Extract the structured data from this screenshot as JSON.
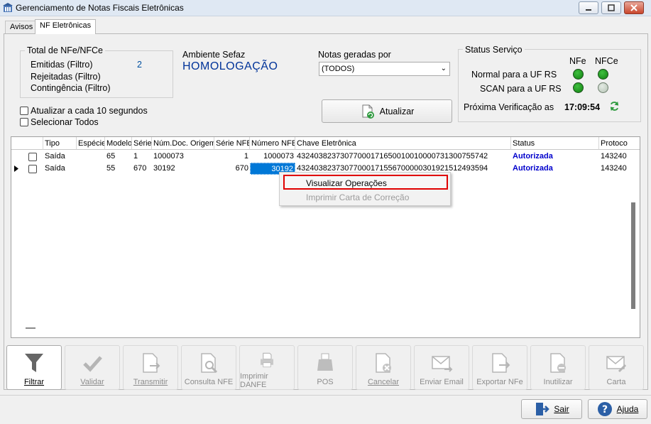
{
  "window": {
    "title": "Gerenciamento de Notas Fiscais Eletrônicas"
  },
  "tabs": [
    {
      "label": "Avisos"
    },
    {
      "label": "NF Eletrônicas"
    }
  ],
  "totals": {
    "legend": "Total de NFe/NFCe",
    "emitidas_label": "Emitidas (Filtro)",
    "emitidas_value": "2",
    "rejeitadas_label": "Rejeitadas (Filtro)",
    "contingencia_label": "Contingência (Filtro)"
  },
  "ambiente": {
    "label": "Ambiente Sefaz",
    "value": "HOMOLOGAÇÃO",
    "value_color": "#003399"
  },
  "notas": {
    "label": "Notas geradas por",
    "selected": "(TODOS)"
  },
  "options": {
    "auto_refresh_label": "Atualizar a cada 10 segundos",
    "select_all_label": "Selecionar Todos"
  },
  "refresh_button": {
    "label": "Atualizar"
  },
  "status": {
    "legend": "Status Serviço",
    "col_nfe": "NFe",
    "col_nfce": "NFCe",
    "rows": [
      {
        "label": "Normal para a UF RS",
        "nfe": "on",
        "nfce": "on"
      },
      {
        "label": "SCAN para a UF RS",
        "nfe": "on",
        "nfce": "off"
      }
    ],
    "next_check_label": "Próxima Verificação as",
    "next_check_time": "17:09:54"
  },
  "grid": {
    "columns": [
      "Tipo",
      "Espécie",
      "Modelo",
      "Série",
      "Núm.Doc. Origem",
      "Série NFE",
      "Número NFE",
      "Chave Eletrônica",
      "Status",
      "Protoco"
    ],
    "rows": [
      {
        "tipo": "Saída",
        "especie": "",
        "modelo": "65",
        "serie": "1",
        "num_doc": "1000073",
        "serie_nfe": "1",
        "numero_nfe": "1000073",
        "chave": "43240382373077000171650010010000731300755742",
        "status": "Autorizada",
        "protocolo": "143240"
      },
      {
        "tipo": "Saída",
        "especie": "",
        "modelo": "55",
        "serie": "670",
        "num_doc": "30192",
        "serie_nfe": "670",
        "numero_nfe": "30192",
        "chave": "43240382373077000171556700000301921512493594",
        "status": "Autorizada",
        "protocolo": "143240"
      }
    ]
  },
  "context_menu": {
    "items": [
      {
        "label": "Visualizar Operações",
        "enabled": true
      },
      {
        "label": "Imprimir Carta de Correção",
        "enabled": false
      }
    ]
  },
  "toolbar": {
    "buttons": [
      {
        "label": "Filtrar",
        "icon": "filter-icon",
        "enabled": true
      },
      {
        "label": "Validar",
        "icon": "check-icon",
        "enabled": false
      },
      {
        "label": "Transmitir",
        "icon": "document-send-icon",
        "enabled": false
      },
      {
        "label": "Consulta NFE",
        "icon": "document-search-icon",
        "enabled": false
      },
      {
        "label": "Imprimir DANFE",
        "icon": "printer-icon",
        "enabled": false
      },
      {
        "label": "POS",
        "icon": "pos-printer-icon",
        "enabled": false
      },
      {
        "label": "Cancelar",
        "icon": "document-cancel-icon",
        "enabled": false
      },
      {
        "label": "Enviar Email",
        "icon": "email-icon",
        "enabled": false
      },
      {
        "label": "Exportar NFe",
        "icon": "document-export-icon",
        "enabled": false
      },
      {
        "label": "Inutilizar",
        "icon": "document-disable-icon",
        "enabled": false
      },
      {
        "label": "Carta",
        "icon": "letter-icon",
        "enabled": false
      }
    ]
  },
  "footer": {
    "sair_label": "Sair",
    "ajuda_label": "Ajuda"
  }
}
